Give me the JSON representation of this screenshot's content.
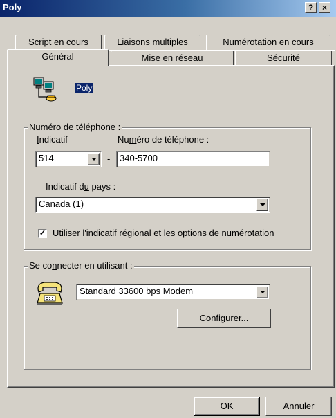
{
  "window": {
    "title": "Poly",
    "help_button": "?",
    "close_button": "×"
  },
  "tabs": {
    "back_row": [
      "Script en cours",
      "Liaisons multiples",
      "Numérotation en cours"
    ],
    "front_row": [
      "Général",
      "Mise en réseau",
      "Sécurité"
    ],
    "active": "Général"
  },
  "connection": {
    "icon": "network-connection-icon",
    "name": "Poly"
  },
  "phone_group": {
    "legend": "Numéro de téléphone :",
    "area_code_label_pre": "",
    "area_code_label_ul": "I",
    "area_code_label_post": "ndicatif",
    "area_code_value": "514",
    "separator": "-",
    "phone_label_pre": "Nu",
    "phone_label_ul": "m",
    "phone_label_post": "éro de téléphone :",
    "phone_value": "340-5700",
    "country_label_pre": "Indicatif d",
    "country_label_ul": "u",
    "country_label_post": " pays :",
    "country_value": "Canada (1)",
    "use_dialing_checked": true,
    "use_dialing_pre": "Utili",
    "use_dialing_ul": "s",
    "use_dialing_post": "er l'indicatif régional et les options de numérotation"
  },
  "connect_group": {
    "legend_pre": "Se co",
    "legend_ul": "n",
    "legend_post": "necter en utilisant :",
    "modem_icon": "modem-phone-icon",
    "modem_value": "Standard 33600 bps Modem",
    "configure_ul": "C",
    "configure_post": "onfigurer..."
  },
  "footer": {
    "ok_label": "OK",
    "cancel_label": "Annuler"
  }
}
